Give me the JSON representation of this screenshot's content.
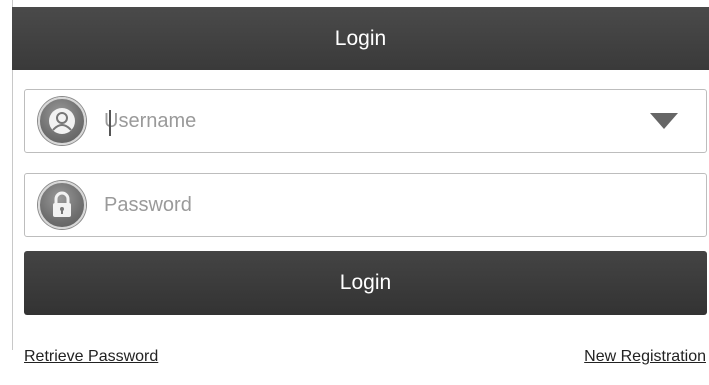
{
  "header": {
    "title": "Login"
  },
  "username": {
    "icon": "user-icon",
    "placeholder": "Username",
    "value": "",
    "dropdown_icon": "dropdown-triangle-icon"
  },
  "password": {
    "icon": "lock-icon",
    "placeholder": "Password",
    "value": ""
  },
  "login_button": {
    "label": "Login"
  },
  "links": {
    "retrieve_password": "Retrieve Password",
    "new_registration": "New Registration"
  },
  "colors": {
    "header_bg": "#3f3f3f",
    "button_bg": "#3a3a3a",
    "border": "#bdbdbd",
    "placeholder": "#9a9a9a"
  }
}
